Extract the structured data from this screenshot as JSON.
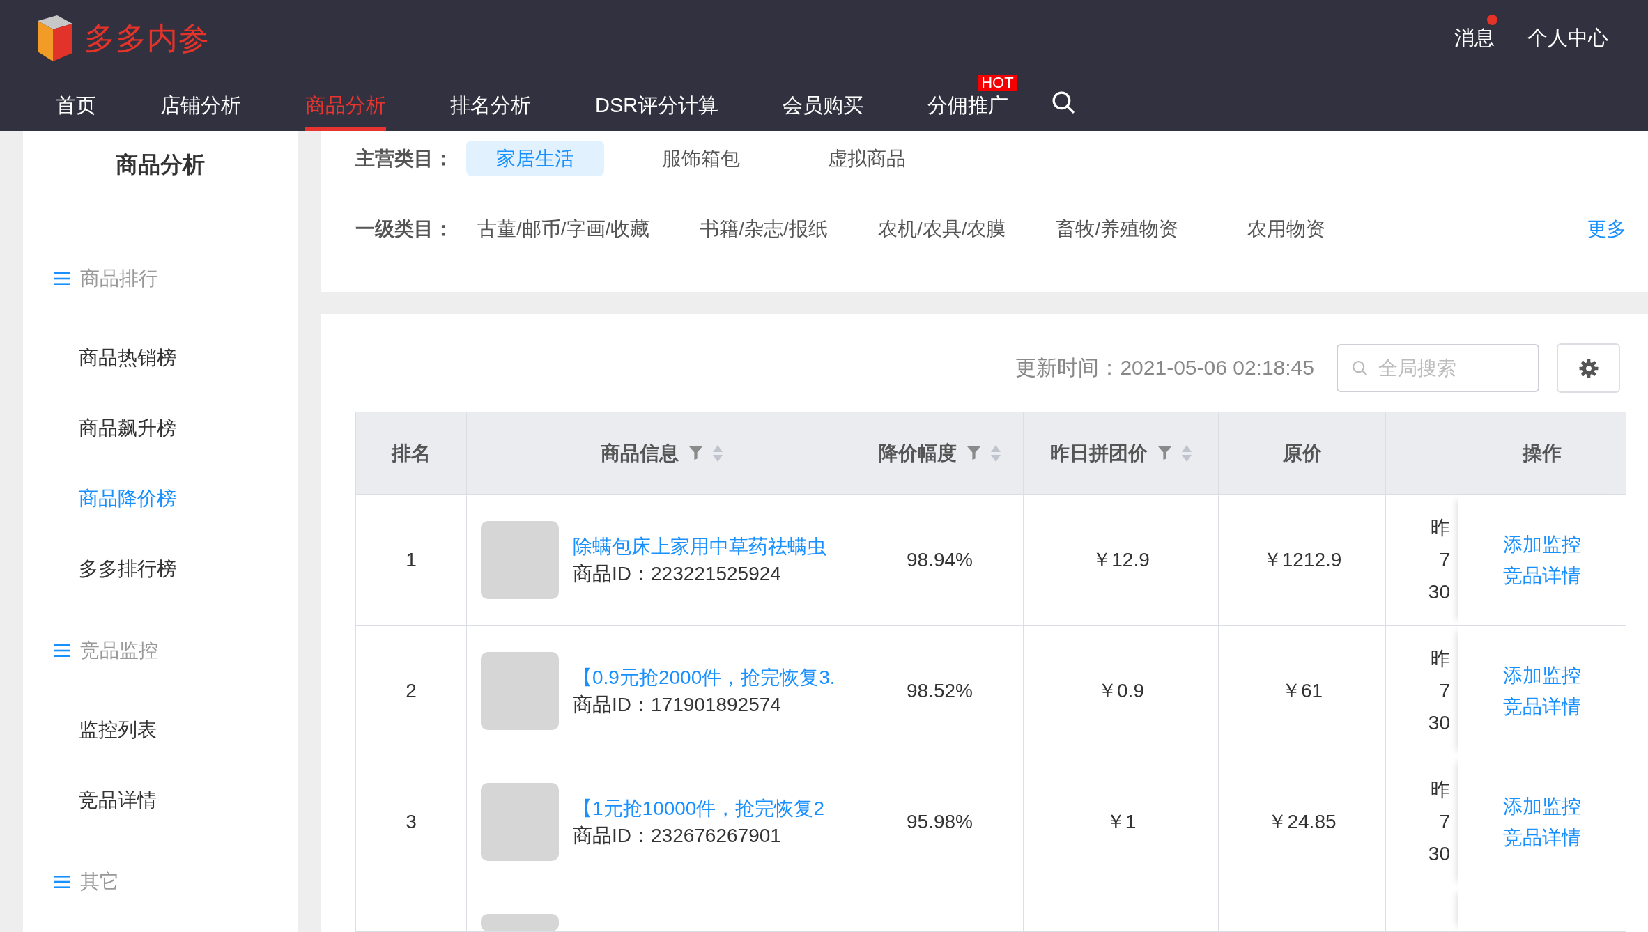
{
  "header": {
    "logo_text": "多多内参",
    "nav": [
      {
        "label": "首页",
        "selected": false
      },
      {
        "label": "店铺分析",
        "selected": false
      },
      {
        "label": "商品分析",
        "selected": true
      },
      {
        "label": "排名分析",
        "selected": false
      },
      {
        "label": "DSR评分计算",
        "selected": false
      },
      {
        "label": "会员购买",
        "selected": false
      },
      {
        "label": "分佣推广",
        "selected": false,
        "badge": "HOT"
      }
    ],
    "user_links": [
      {
        "label": "消息",
        "unread": true
      },
      {
        "label": "个人中心",
        "unread": false
      }
    ]
  },
  "sidebar": {
    "title": "商品分析",
    "sections": [
      {
        "label": "商品排行",
        "items": [
          {
            "label": "商品热销榜",
            "selected": false
          },
          {
            "label": "商品飙升榜",
            "selected": false
          },
          {
            "label": "商品降价榜",
            "selected": true
          },
          {
            "label": "多多排行榜",
            "selected": false
          }
        ]
      },
      {
        "label": "竞品监控",
        "items": [
          {
            "label": "监控列表",
            "selected": false
          },
          {
            "label": "竞品详情",
            "selected": false
          }
        ]
      },
      {
        "label": "其它"
      }
    ]
  },
  "filters": [
    {
      "label": "主营类目：",
      "options": [
        {
          "label": "家居生活",
          "selected": true
        },
        {
          "label": "服饰箱包",
          "selected": false
        },
        {
          "label": "虚拟商品",
          "selected": false
        }
      ]
    },
    {
      "label": "一级类目：",
      "options": [
        {
          "label": "古董/邮币/字画/收藏",
          "selected": false
        },
        {
          "label": "书籍/杂志/报纸",
          "selected": false
        },
        {
          "label": "农机/农具/农膜",
          "selected": false
        },
        {
          "label": "畜牧/养殖物资",
          "selected": false
        },
        {
          "label": "农用物资",
          "selected": false
        }
      ],
      "more": "更多"
    }
  ],
  "toolbar": {
    "updated": "更新时间：2021-05-06 02:18:45",
    "search": {
      "placeholder": "全局搜索"
    }
  },
  "table": {
    "columns": [
      {
        "label": "排名"
      },
      {
        "label": "商品信息",
        "filter": true,
        "sort": true
      },
      {
        "label": "降价幅度",
        "filter": true,
        "sort": true
      },
      {
        "label": "昨日拼团价",
        "filter": true,
        "sort": true
      },
      {
        "label": "原价"
      },
      {},
      {
        "label": "操作"
      }
    ],
    "rows": [
      {
        "rank": "1",
        "photo": true,
        "title": "除螨包床上家用中草药祛螨虫",
        "product_id": "商品ID：223221525924",
        "price_drop": "98.94%",
        "group_price": "￥12.9",
        "original_price": "￥1212.9",
        "column_6": [
          "昨",
          "7",
          "30"
        ],
        "actions": [
          "添加监控",
          "竞品详情"
        ]
      },
      {
        "rank": "2",
        "photo": true,
        "title": "【0.9元抢2000件，抢完恢复3.",
        "product_id": "商品ID：171901892574",
        "price_drop": "98.52%",
        "group_price": "￥0.9",
        "original_price": "￥61",
        "column_6": [
          "昨",
          "7",
          "30"
        ],
        "actions": [
          "添加监控",
          "竞品详情"
        ]
      },
      {
        "rank": "3",
        "photo": true,
        "title": "【1元抢10000件，抢完恢复2",
        "product_id": "商品ID：232676267901",
        "price_drop": "95.98%",
        "group_price": "￥1",
        "original_price": "￥24.85",
        "column_6": [
          "昨",
          "7",
          "30"
        ],
        "actions": [
          "添加监控",
          "竞品详情"
        ]
      },
      {
        "photo": true
      }
    ]
  }
}
